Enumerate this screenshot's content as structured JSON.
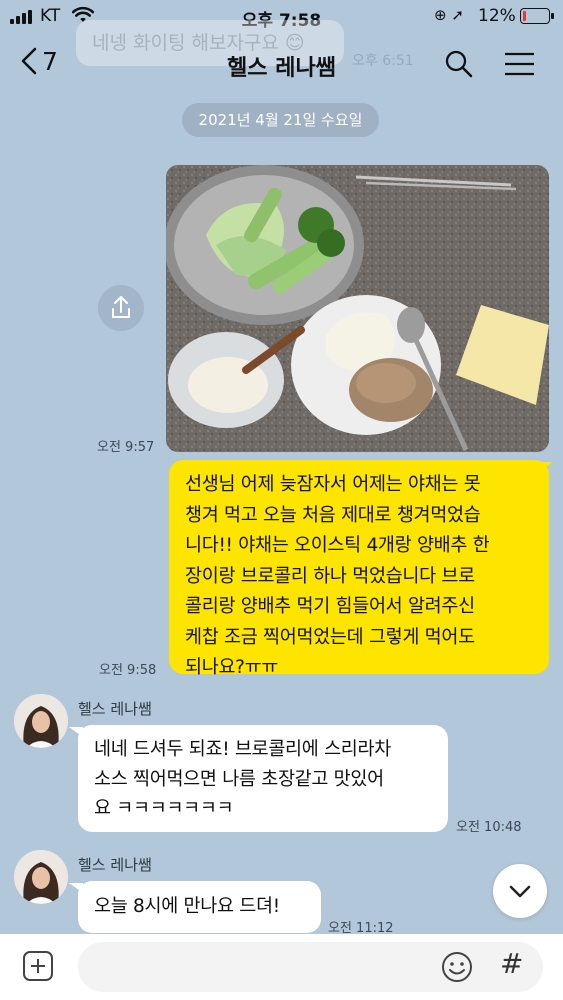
{
  "status_bar": {
    "carrier": "KT",
    "time": "오후 7:58",
    "battery_text": "12%",
    "battery_level": 0.12,
    "battery_color": "#e53935"
  },
  "header": {
    "back_count": "7",
    "title": "헬스 레나쌤",
    "icons": [
      "chevron-left-icon",
      "search-icon",
      "menu-icon"
    ]
  },
  "ghost": {
    "text": "네넹 화이팅 해보자구요 😊",
    "time": "오후 6:51"
  },
  "date_divider": "2021년 4월 21일 수요일",
  "messages": {
    "photo": {
      "time": "오전 9:57",
      "description_icon": "share-icon"
    },
    "mine": {
      "lines": [
        "선생님 어제 늦잠자서 어제는 야채는 못",
        "챙겨 먹고 오늘 처음 제대로 챙겨먹었습",
        "니다!! 야채는 오이스틱 4개랑 양배추 한",
        "장이랑 브로콜리 하나 먹었습니다 브로",
        "콜리랑 양배추 먹기 힘들어서 알려주신",
        "케찹 조금 찍어먹었는데 그렇게 먹어도",
        "되나요?ㅠㅠ"
      ],
      "time": "오전 9:58",
      "color": "#fee500"
    },
    "reply1": {
      "sender": "헬스 레나쌤",
      "lines": [
        "네네 드셔두 되죠! 브로콜리에 스리라차",
        "소스 찍어먹으면 나름 초장같고 맛있어",
        "요 ㅋㅋㅋㅋㅋㅋㅋ"
      ],
      "time": "오전 10:48"
    },
    "reply2": {
      "sender": "헬스 레나쌤",
      "text": "오늘 8시에 만나요 드뎌!",
      "time": "오전 11:12"
    }
  },
  "input": {
    "placeholder": ""
  },
  "colors": {
    "background": "#b2c7d9",
    "my_bubble": "#fee500",
    "their_bubble": "#ffffff"
  }
}
